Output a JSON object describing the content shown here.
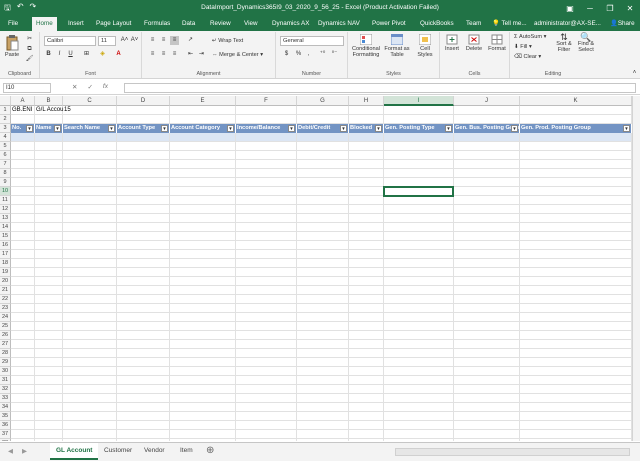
{
  "window": {
    "title": "DataImport_Dynamics365I9_03_2020_9_56_25 - Excel (Product Activation Failed)",
    "user": "administrator@AX-SE...",
    "share": "Share",
    "tell_me": "Tell me..."
  },
  "tabs": [
    "File",
    "Home",
    "Insert",
    "Page Layout",
    "Formulas",
    "Data",
    "Review",
    "View",
    "Dynamics AX",
    "Dynamics NAV",
    "Power Pivot",
    "QuickBooks",
    "Team"
  ],
  "ribbon": {
    "clipboard": {
      "paste": "Paste",
      "label": "Clipboard"
    },
    "font": {
      "name": "Calibri",
      "size": "11",
      "label": "Font",
      "bold": "B",
      "italic": "I",
      "underline": "U"
    },
    "alignment": {
      "wrap": "Wrap Text",
      "merge": "Merge & Center",
      "label": "Alignment"
    },
    "number": {
      "format": "General",
      "currency": "$",
      "percent": "%",
      "comma": ",",
      "label": "Number"
    },
    "styles": {
      "conditional": "Conditional Formatting",
      "format_table": "Format as Table",
      "cell_styles": "Cell Styles",
      "label": "Styles"
    },
    "cells": {
      "insert": "Insert",
      "delete": "Delete",
      "format": "Format",
      "label": "Cells"
    },
    "editing": {
      "autosum": "AutoSum",
      "fill": "Fill",
      "clear": "Clear",
      "sort": "Sort & Filter",
      "find": "Find & Select",
      "label": "Editing"
    }
  },
  "formula_bar": {
    "name_box": "I10",
    "fx": "fx",
    "cancel": "✕",
    "enter": "✓",
    "value": ""
  },
  "grid": {
    "columns": [
      "A",
      "B",
      "C",
      "D",
      "E",
      "F",
      "G",
      "H",
      "I",
      "J",
      "K"
    ],
    "selected_column": "I",
    "rows": [
      "1",
      "2",
      "3",
      "4",
      "5",
      "6",
      "7",
      "8",
      "9",
      "10",
      "11",
      "12",
      "13",
      "14",
      "15",
      "16",
      "17",
      "18",
      "19",
      "20",
      "21",
      "22",
      "23",
      "24",
      "25",
      "26",
      "27",
      "28",
      "29",
      "30",
      "31",
      "32",
      "33",
      "34",
      "35",
      "36",
      "37",
      "38"
    ],
    "selected_row": "10",
    "row1": {
      "a": "GB.ENI",
      "b": "G/L Accou",
      "c": "15"
    },
    "headers": [
      "No.",
      "Name",
      "Search Name",
      "Account Type",
      "Account Category",
      "Income/Balance",
      "Debit/Credit",
      "Blocked",
      "Gen. Posting Type",
      "Gen. Bus. Posting Group",
      "Gen. Prod. Posting Group"
    ]
  },
  "sheets": [
    "GL Account",
    "Customer",
    "Vendor",
    "Item"
  ],
  "active_sheet": "GL Account",
  "colors": {
    "excel_green": "#217346",
    "table_header": "#7394c4",
    "table_band": "#dce6f4"
  }
}
